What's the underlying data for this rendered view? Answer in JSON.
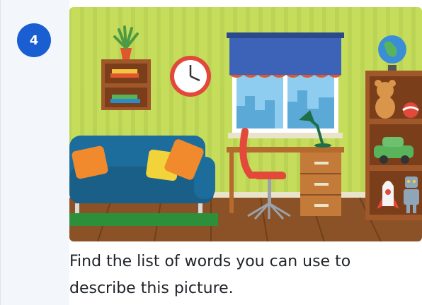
{
  "step": {
    "number": "4"
  },
  "scene": {
    "description_icons": [
      "plant-icon",
      "clock-icon",
      "window-icon",
      "sofa-icon",
      "desk-icon",
      "lamp-icon",
      "chair-icon",
      "globe-icon",
      "teddy-bear-icon",
      "ball-icon",
      "toy-car-icon",
      "rocket-icon",
      "robot-icon",
      "books-icon"
    ]
  },
  "prompt": {
    "text": "Find the list of words you can use to describe this picture."
  },
  "colors": {
    "badge": "#1a5fd1",
    "wall": "#c6dd5b",
    "floor": "#8a5226",
    "sofa": "#1d6d9c",
    "curtain": "#3c63b8"
  }
}
